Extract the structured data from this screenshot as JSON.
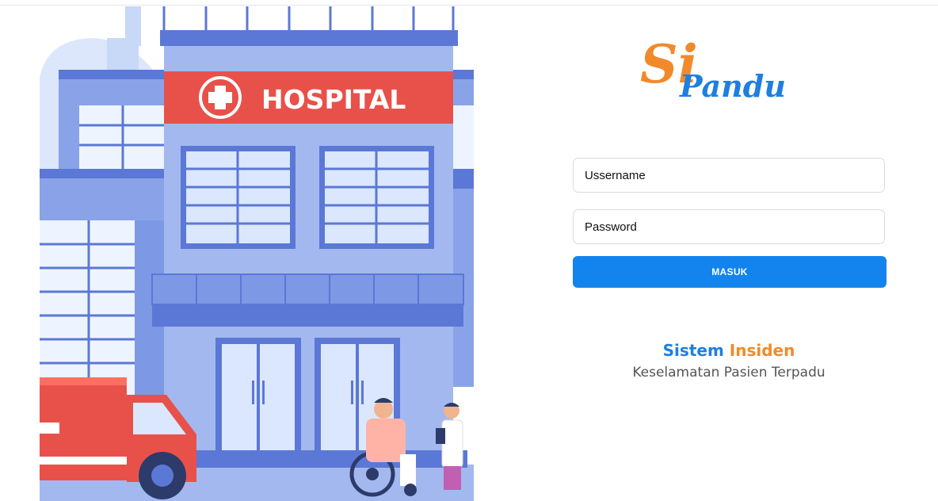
{
  "logo": {
    "si": "Si",
    "pandu": "Pandu"
  },
  "illustration": {
    "sign_text": "HOSPITAL"
  },
  "form": {
    "username_placeholder": "Ussername",
    "password_placeholder": "Password",
    "submit_label": "MASUK"
  },
  "tagline": {
    "word1": "Sistem",
    "word2": "Insiden",
    "subtitle": "Keselamatan Pasien Terpadu"
  },
  "colors": {
    "accent_blue": "#1384ee",
    "accent_orange": "#f08a2b",
    "sign_red": "#e8514a",
    "building_blue": "#6f8fe0"
  }
}
